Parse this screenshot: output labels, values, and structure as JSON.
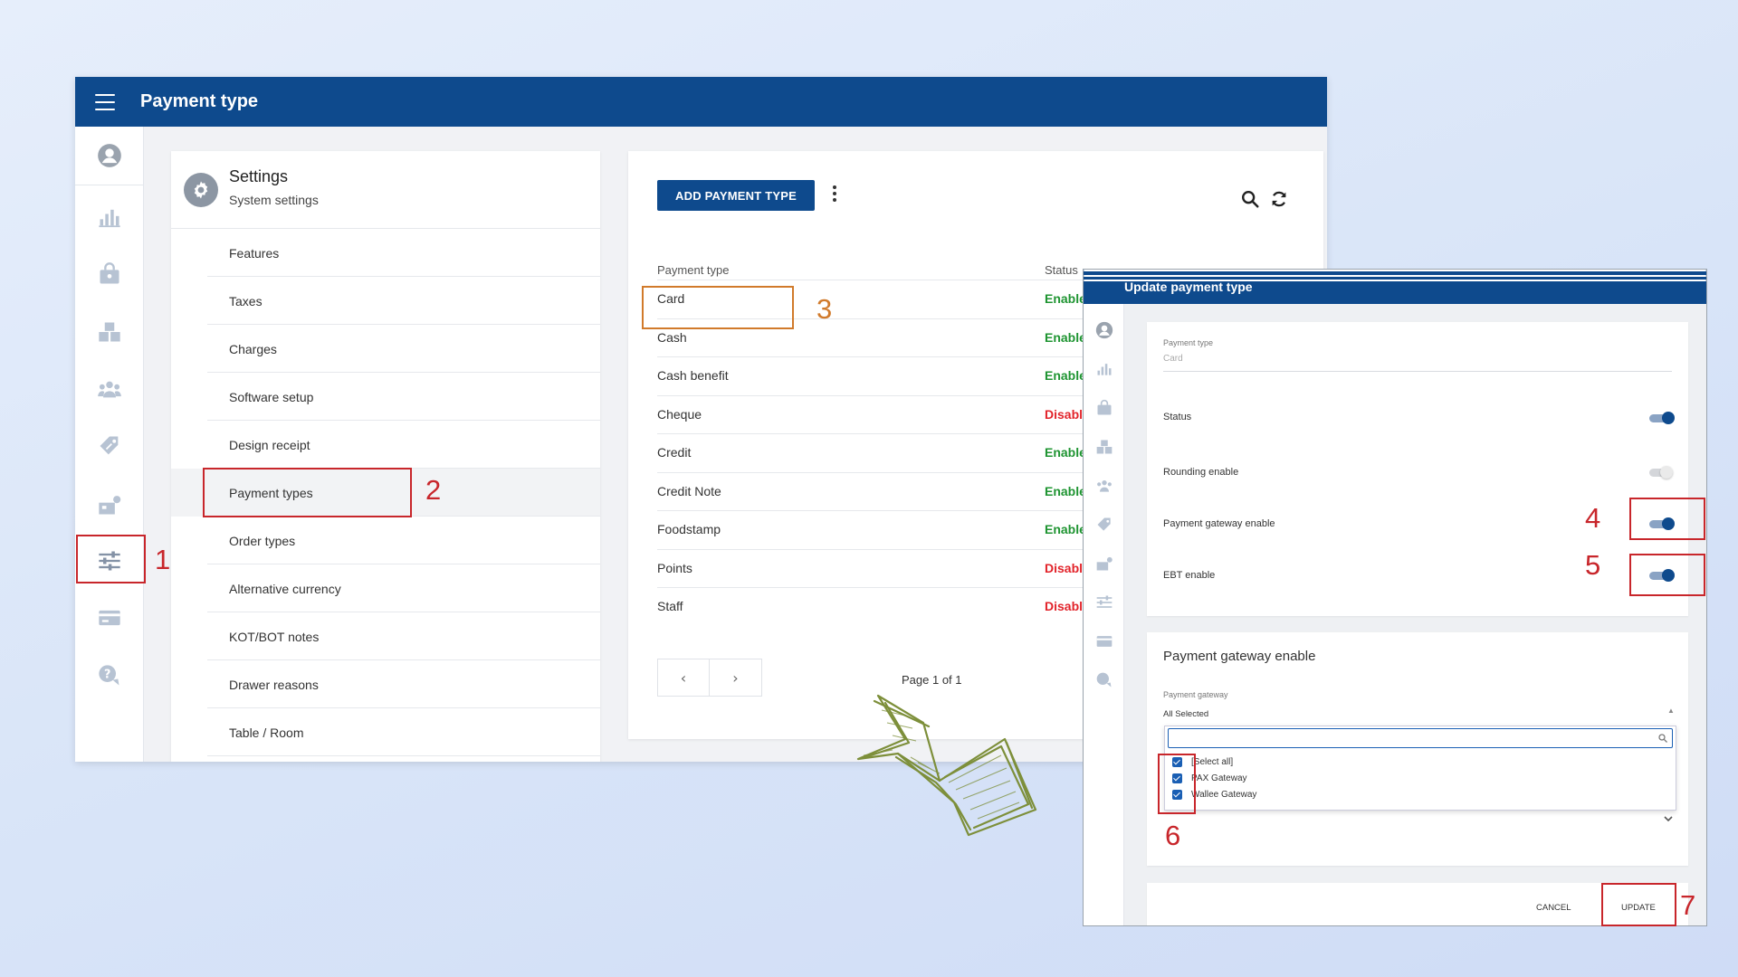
{
  "main": {
    "title": "Payment type",
    "settings": {
      "title": "Settings",
      "subtitle": "System settings",
      "items": [
        {
          "label": "Features"
        },
        {
          "label": "Taxes"
        },
        {
          "label": "Charges"
        },
        {
          "label": "Software setup"
        },
        {
          "label": "Design receipt"
        },
        {
          "label": "Payment types"
        },
        {
          "label": "Order types"
        },
        {
          "label": "Alternative currency"
        },
        {
          "label": "KOT/BOT notes"
        },
        {
          "label": "Drawer reasons"
        },
        {
          "label": "Table / Room"
        }
      ]
    },
    "list": {
      "add_label": "ADD PAYMENT TYPE",
      "col_type": "Payment type",
      "col_status": "Status",
      "rows": [
        {
          "name": "Card",
          "status": "Enable"
        },
        {
          "name": "Cash",
          "status": "Enable"
        },
        {
          "name": "Cash benefit",
          "status": "Enable"
        },
        {
          "name": "Cheque",
          "status": "Disable"
        },
        {
          "name": "Credit",
          "status": "Enable"
        },
        {
          "name": "Credit Note",
          "status": "Enable"
        },
        {
          "name": "Foodstamp",
          "status": "Enable"
        },
        {
          "name": "Points",
          "status": "Disable"
        },
        {
          "name": "Staff",
          "status": "Disable"
        }
      ],
      "prev_glyph": "‹",
      "next_glyph": "›",
      "page_label": "Page 1 of 1"
    }
  },
  "update": {
    "title": "Update payment type",
    "payment_type_label": "Payment type",
    "payment_type_value": "Card",
    "status_label": "Status",
    "status_on": true,
    "rounding_label": "Rounding enable",
    "rounding_on": false,
    "gateway_label": "Payment gateway enable",
    "gateway_on": true,
    "ebt_label": "EBT enable",
    "ebt_on": true,
    "gateway_section_title": "Payment gateway enable",
    "gateway_field_label": "Payment gateway",
    "gateway_field_value": "All Selected",
    "options": [
      {
        "label": "[Select all]",
        "checked": true
      },
      {
        "label": "PAX Gateway",
        "checked": true
      },
      {
        "label": "Wallee Gateway",
        "checked": true
      }
    ],
    "cancel_label": "CANCEL",
    "update_label": "UPDATE"
  },
  "annotations": [
    "1",
    "2",
    "3",
    "4",
    "5",
    "6",
    "7"
  ],
  "colors": {
    "brand": "#0e4a8d",
    "enable": "#1e9431",
    "disable": "#e2232a",
    "annotation_red": "#c8262b",
    "annotation_orange": "#d17a2b",
    "arrow": "#7d8f3a"
  },
  "icons": [
    "menu-icon",
    "user-icon",
    "chart-icon",
    "bag-icon",
    "boxes-icon",
    "people-icon",
    "tag-icon",
    "register-icon",
    "sliders-icon",
    "card-icon",
    "help-icon",
    "gear-icon",
    "search-icon",
    "refresh-icon",
    "more-icon",
    "chevron-down-icon"
  ]
}
